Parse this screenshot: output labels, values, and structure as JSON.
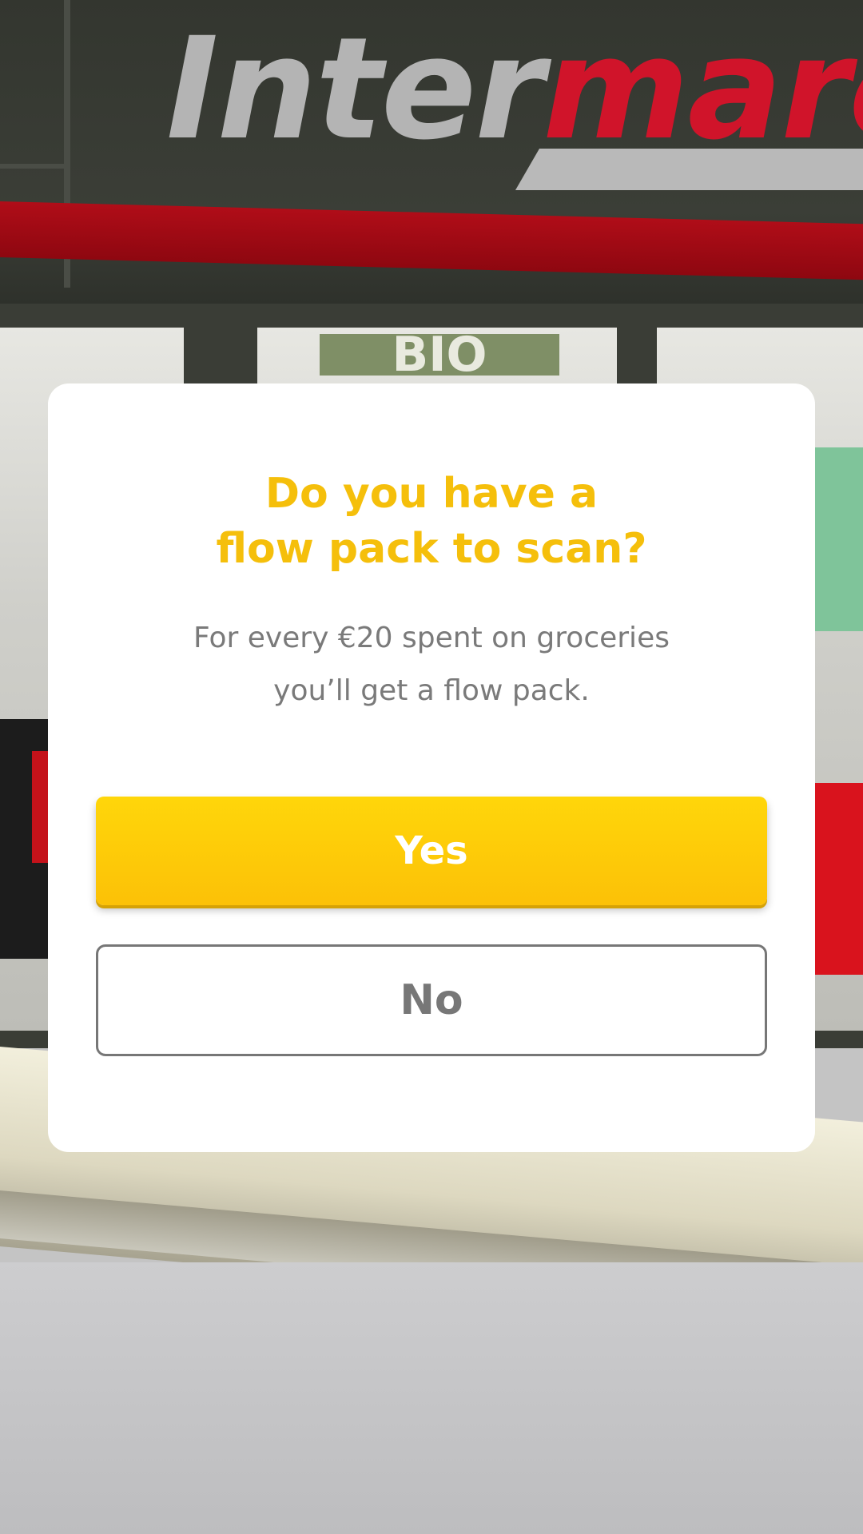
{
  "background": {
    "store_logo_part1": "Inter",
    "store_logo_part2": "marc",
    "window_sign": "BIO"
  },
  "dialog": {
    "title_line1": "Do you have a",
    "title_line2": "flow pack to scan?",
    "description_line1": "For every €20 spent on groceries",
    "description_line2": "you’ll get a flow pack.",
    "yes_label": "Yes",
    "no_label": "No"
  },
  "colors": {
    "title": "#f5bf0b",
    "yes_button": "#fcc107",
    "no_button_border": "#777777",
    "description": "#7a7a7a",
    "brand_red": "#d0142a"
  }
}
